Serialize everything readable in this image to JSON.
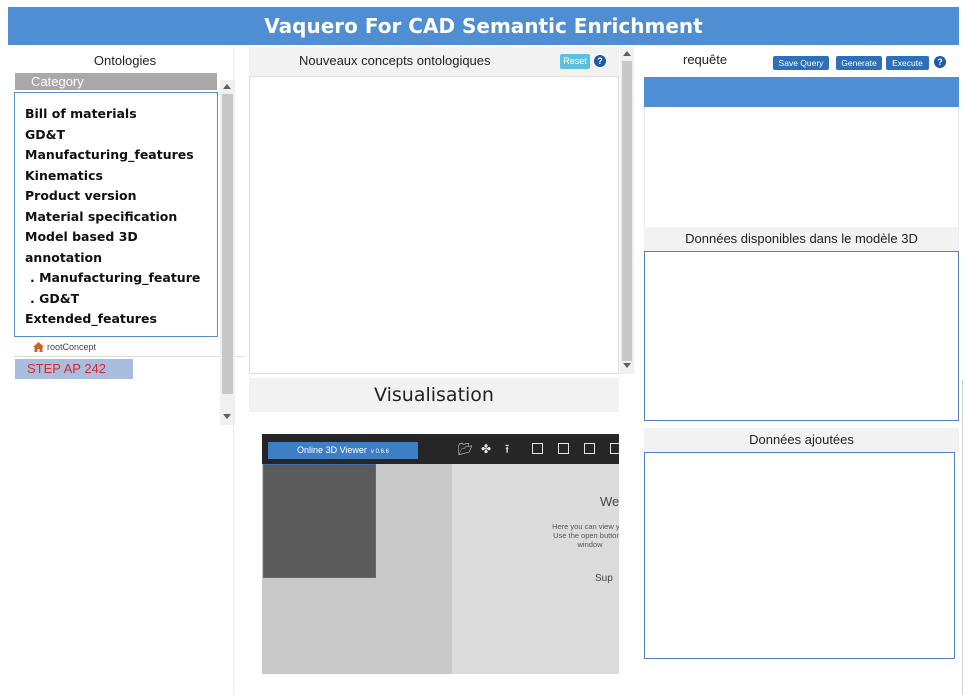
{
  "app": {
    "title": "Vaquero For CAD Semantic Enrichment"
  },
  "left": {
    "title": "Ontologies",
    "category_label": "Category",
    "items": [
      "Bill of materials",
      "GD&T",
      "Manufacturing_features",
      "Kinematics",
      "Product version",
      "Material specification",
      "Model based 3D",
      "annotation",
      ". Manufacturing_feature",
      ". GD&T",
      "Extended_features"
    ],
    "root_concept": "rootConcept",
    "step_label": "STEP AP 242",
    "step_color": "#d62a2a"
  },
  "middle": {
    "title": "Nouveaux concepts ontologiques",
    "reset_label": "Reset",
    "help_glyph": "?",
    "visualisation_label": "Visualisation",
    "viewer": {
      "tab_label": "Online 3D Viewer",
      "version": "v 0.6.6",
      "welcome_partial": "We",
      "text_lines": [
        "Here you can view you",
        "Use the open button a",
        "window"
      ],
      "supported_partial": "Sup",
      "toolbar_icons": [
        "folder-open-icon",
        "move-icon",
        "upload-icon",
        "cube-front-icon",
        "cube-side-icon",
        "cube-top-icon",
        "cube-iso-icon"
      ]
    }
  },
  "right": {
    "title": "requête",
    "save_query_label": "Save Query",
    "generate_label": "Generate",
    "execute_label": "Execute",
    "help_glyph": "?",
    "available_label": "Données disponibles dans le modèle 3D",
    "added_label": "Données ajoutées",
    "accent_color": "#4f8ed3"
  }
}
